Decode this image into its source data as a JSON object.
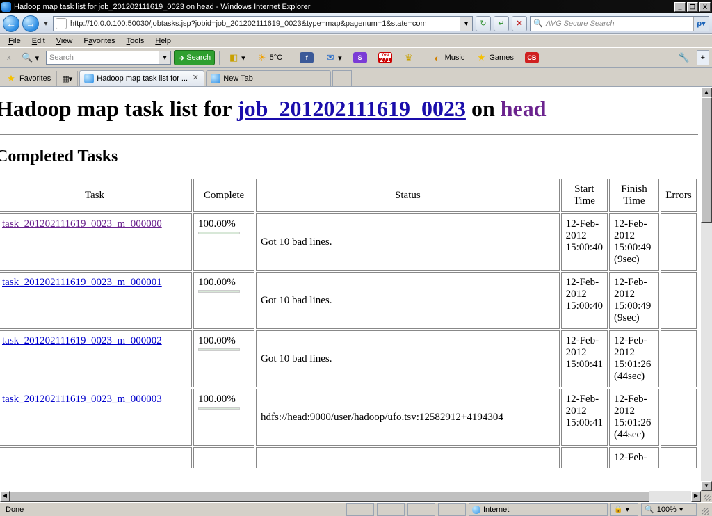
{
  "window": {
    "title": "Hadoop map task list for job_201202111619_0023 on head - Windows Internet Explorer",
    "minimize": "_",
    "restore": "❐",
    "close": "X"
  },
  "address": {
    "url": "http://10.0.0.100:50030/jobtasks.jsp?jobid=job_201202111619_0023&type=map&pagenum=1&state=com",
    "search_placeholder": "AVG Secure Search",
    "go": "→",
    "refresh": "⟳",
    "stop": "✕",
    "search_go": "ρ"
  },
  "menus": {
    "file": "File",
    "edit": "Edit",
    "view": "View",
    "favorites": "Favorites",
    "tools": "Tools",
    "help": "Help"
  },
  "toolbar": {
    "close_bar": "x",
    "search_label": "Search",
    "search_placeholder": "Search",
    "temp": "5°C",
    "music": "Music",
    "games": "Games",
    "yt_count": "271",
    "plus": "+"
  },
  "tabs": {
    "favorites": "Favorites",
    "tab1": "Hadoop map task list for ...",
    "tab2": "New Tab"
  },
  "page": {
    "title_prefix": "Hadoop map task list for ",
    "job_link": "job_201202111619_0023",
    "on_text": " on ",
    "head_link": "head",
    "section": "Completed Tasks",
    "headers": {
      "task": "Task",
      "complete": "Complete",
      "status": "Status",
      "start": "Start Time",
      "finish": "Finish Time",
      "errors": "Errors"
    },
    "rows": [
      {
        "task": "task_201202111619_0023_m_000000",
        "visited": true,
        "complete": "100.00%",
        "status": "Got 10 bad lines.",
        "start": "12-Feb-2012 15:00:40",
        "finish": "12-Feb-2012 15:00:49 (9sec)",
        "errors": ""
      },
      {
        "task": "task_201202111619_0023_m_000001",
        "visited": false,
        "complete": "100.00%",
        "status": "Got 10 bad lines.",
        "start": "12-Feb-2012 15:00:40",
        "finish": "12-Feb-2012 15:00:49 (9sec)",
        "errors": ""
      },
      {
        "task": "task_201202111619_0023_m_000002",
        "visited": false,
        "complete": "100.00%",
        "status": "Got 10 bad lines.",
        "start": "12-Feb-2012 15:00:41",
        "finish": "12-Feb-2012 15:01:26 (44sec)",
        "errors": ""
      },
      {
        "task": "task_201202111619_0023_m_000003",
        "visited": false,
        "complete": "100.00%",
        "status": "hdfs://head:9000/user/hadoop/ufo.tsv:12582912+4194304",
        "start": "12-Feb-2012 15:00:41",
        "finish": "12-Feb-2012 15:01:26 (44sec)",
        "errors": ""
      }
    ]
  },
  "status": {
    "done": "Done",
    "zone": "Internet",
    "zoom": "100%"
  }
}
